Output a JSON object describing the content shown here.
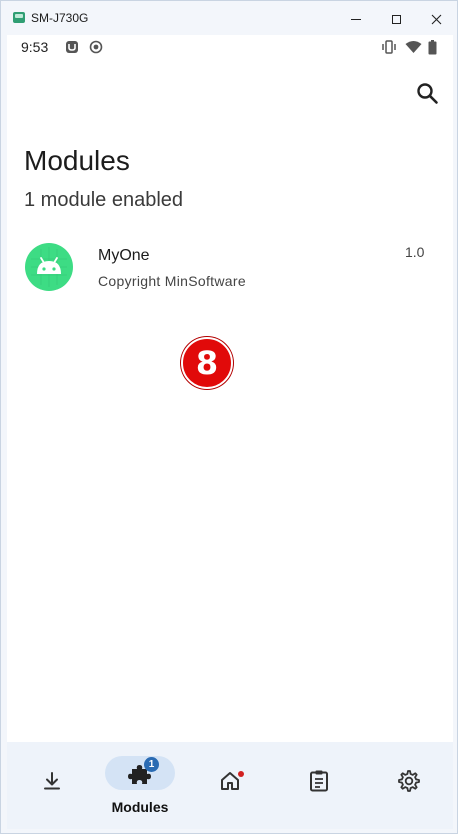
{
  "window": {
    "title": "SM-J730G",
    "minimize_icon": "minimize-icon",
    "maximize_icon": "maximize-icon",
    "close_icon": "close-icon"
  },
  "statusbar": {
    "time": "9:53",
    "icons": [
      "notification-icon",
      "record-icon",
      "vibrate-icon",
      "wifi-icon",
      "battery-icon"
    ]
  },
  "header": {
    "search_icon": "search-icon"
  },
  "page": {
    "title": "Modules",
    "subtitle": "1 module enabled"
  },
  "modules": [
    {
      "name": "MyOne",
      "description": "Copyright MinSoftware",
      "version": "1.0",
      "icon": "android-icon"
    }
  ],
  "overlay": {
    "step_marker": "8"
  },
  "bottom_nav": {
    "items": [
      {
        "id": "downloads",
        "icon": "download-icon",
        "label": ""
      },
      {
        "id": "modules",
        "icon": "puzzle-icon",
        "label": "Modules",
        "badge": "1",
        "selected": true
      },
      {
        "id": "home",
        "icon": "home-icon",
        "label": "",
        "dot": true
      },
      {
        "id": "logs",
        "icon": "clipboard-icon",
        "label": ""
      },
      {
        "id": "settings",
        "icon": "gear-icon",
        "label": ""
      }
    ]
  },
  "colors": {
    "accent": "#2a6bb3",
    "pill": "#d4e3f5",
    "nav_bg": "#eef3fa",
    "android_green": "#3ddc84",
    "marker_red": "#e10a0a"
  }
}
